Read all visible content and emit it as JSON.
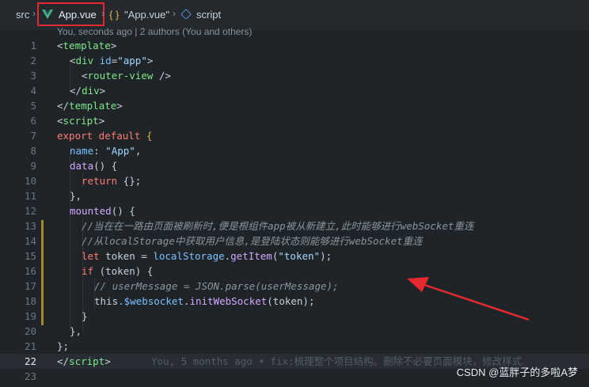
{
  "breadcrumb": {
    "folder": "src",
    "file": "App.vue",
    "braces": "{ }",
    "object": "\"App.vue\"",
    "section": "script"
  },
  "blame_header": "You, seconds ago | 2 authors (You and others)",
  "lines": [
    "1",
    "2",
    "3",
    "4",
    "5",
    "6",
    "7",
    "8",
    "9",
    "10",
    "11",
    "12",
    "13",
    "14",
    "15",
    "16",
    "17",
    "18",
    "19",
    "20",
    "21",
    "22",
    "23"
  ],
  "code": {
    "l1": {
      "a": "<",
      "b": "template",
      "c": ">"
    },
    "l2": {
      "a": "<",
      "b": "div",
      "c": " id",
      "d": "=",
      "e": "\"app\"",
      "f": ">"
    },
    "l3": {
      "a": "<",
      "b": "router-view",
      "c": " />"
    },
    "l4": {
      "a": "</",
      "b": "div",
      "c": ">"
    },
    "l5": {
      "a": "</",
      "b": "template",
      "c": ">"
    },
    "l6": {
      "a": "<",
      "b": "script",
      "c": ">"
    },
    "l7": {
      "a": "export",
      "b": " default",
      "c": " {"
    },
    "l8": {
      "a": "name",
      "b": ": ",
      "c": "\"App\"",
      "d": ","
    },
    "l9": {
      "a": "data",
      "b": "() {"
    },
    "l10": {
      "a": "return",
      "b": " {};"
    },
    "l11": {
      "a": "},"
    },
    "l12": {
      "a": "mounted",
      "b": "() {"
    },
    "l13": "//当在在一路由页面被刷新时,便是根组件app被从新建立,此时能够进行webSocket重连",
    "l14": "//从localStorage中获取用户信息,是登陆状态则能够进行webSocket重连",
    "l15": {
      "a": "let",
      "b": " token",
      "c": " = ",
      "d": "localStorage",
      "e": ".",
      "f": "getItem",
      "g": "(",
      "h": "\"token\"",
      "i": ");"
    },
    "l16": {
      "a": "if",
      "b": " (token) {"
    },
    "l17": "// userMessage = JSON.parse(userMessage);",
    "l18": {
      "a": "this",
      "b": ".$websocket",
      "c": ".",
      "d": "initWebSocket",
      "e": "(token);"
    },
    "l19": {
      "a": "}"
    },
    "l20": {
      "a": "},"
    },
    "l21": {
      "a": "};"
    },
    "l22": {
      "a": "</",
      "b": "script",
      "c": ">"
    }
  },
  "inline_blame": "You, 5 months ago • fix:梳理整个项目结构。删除不必要页面模块，修改样式",
  "watermark": "CSDN @蓝胖子的多啦A梦",
  "colors": {
    "accent_box": "#e5292e",
    "arrow": "#e5292e",
    "vue_green": "#41b883"
  }
}
